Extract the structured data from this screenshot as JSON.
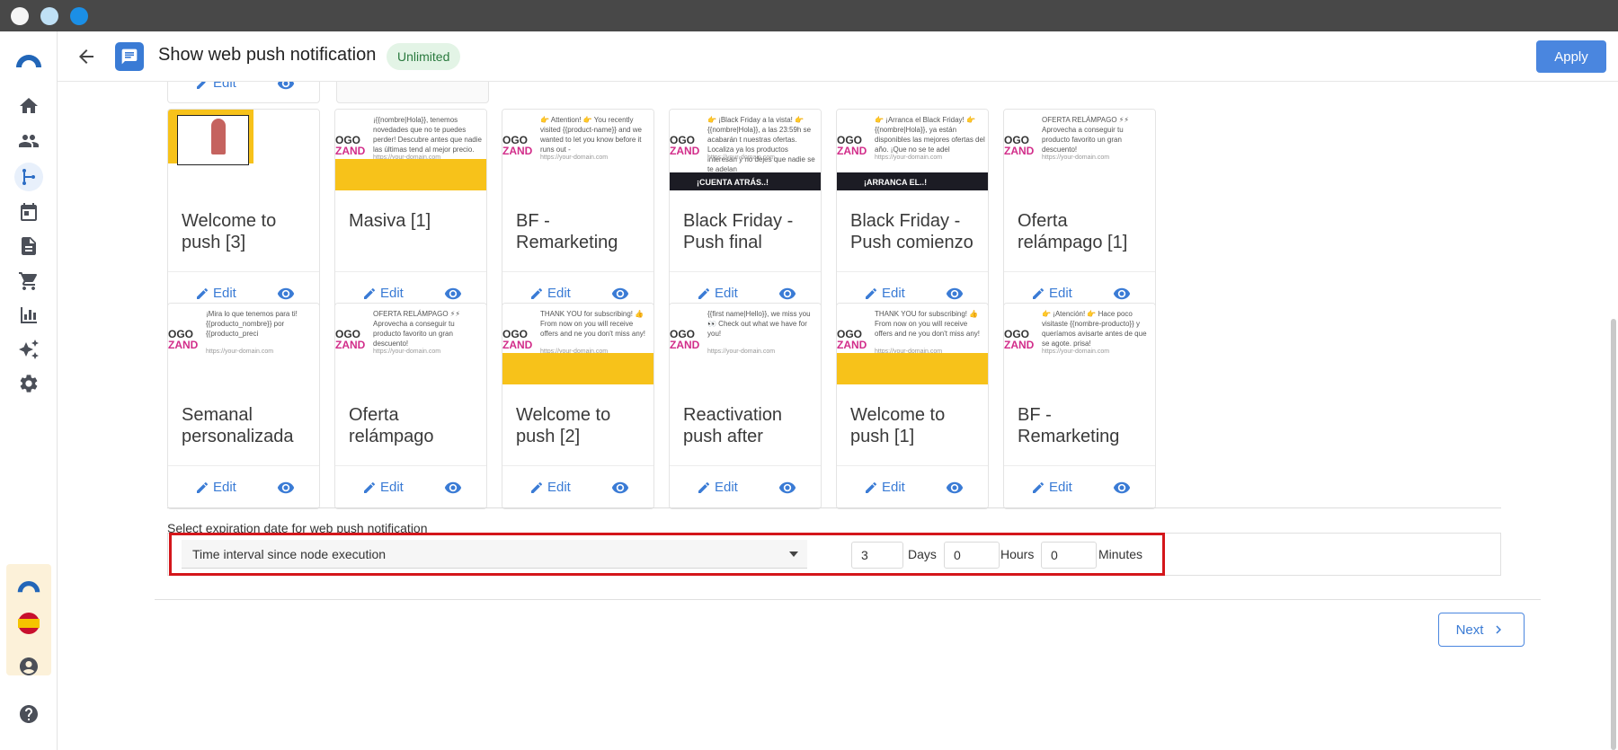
{
  "header": {
    "title": "Show web push notification",
    "badge": "Unlimited",
    "apply_label": "Apply"
  },
  "rail_icons": [
    "home-icon",
    "people-icon",
    "flow-icon",
    "calendar-icon",
    "document-icon",
    "cart-icon",
    "chart-icon",
    "sparkle-icon",
    "gear-icon",
    "account-icon",
    "help-icon"
  ],
  "cards_top": [
    {
      "edit": "Edit"
    }
  ],
  "cards_row1": [
    {
      "name": "Welcome to push [3]",
      "edit": "Edit"
    },
    {
      "name": "Masiva [1]",
      "edit": "Edit",
      "msg": "¡{{nombre|Hola}}, tenemos novedades que no te puedes perder! Descubre antes que nadie las últimas tend al mejor precio.",
      "url": "https://your-domain.com"
    },
    {
      "name": "BF - Remarketing",
      "edit": "Edit",
      "msg": "👉 Attention! 👉 You recently visited {{product-name}} and we wanted to let you know before it runs out -",
      "url": "https://your-domain.com"
    },
    {
      "name": "Black Friday - Push final",
      "edit": "Edit",
      "msg": "👉 ¡Black Friday a la vista! 👉 {{nombre|Hola}}, a las 23:59h se acabarán t nuestras ofertas. Localiza ya los productos interesan y no dejes que nadie se te adelan",
      "url": "https://your-domain.com",
      "banner": "¡CUENTA ATRÁS..!"
    },
    {
      "name": "Black Friday - Push comienzo",
      "edit": "Edit",
      "msg": "👉 ¡Arranca el Black Friday! 👉 {{nombre|Hola}}, ya están disponibles las mejores ofertas del año. ¡Que no se te adel",
      "url": "https://your-domain.com",
      "banner": "¡ARRANCA EL..!"
    },
    {
      "name": "Oferta relámpago [1]",
      "edit": "Edit",
      "msg": "OFERTA RELÁMPAGO ⚡⚡ Aprovecha a conseguir tu producto favorito un gran descuento!",
      "url": "https://your-domain.com"
    }
  ],
  "cards_row2": [
    {
      "name": "Semanal personalizada",
      "edit": "Edit",
      "msg": "¡Mira lo que tenemos para ti! {{producto_nombre}} por {{producto_preci",
      "url": "https://your-domain.com"
    },
    {
      "name": "Oferta relámpago",
      "edit": "Edit",
      "msg": "OFERTA RELÁMPAGO ⚡⚡ Aprovecha a conseguir tu producto favorito un gran descuento!",
      "url": "https://your-domain.com"
    },
    {
      "name": "Welcome to push [2]",
      "edit": "Edit",
      "msg": "THANK YOU for subscribing! 👍 From now on you will receive offers and ne you don't miss any!",
      "url": "https://your-domain.com"
    },
    {
      "name": "Reactivation push after",
      "edit": "Edit",
      "msg": "{{first name|Hello}}, we miss you 👀 Check out what we have for you!",
      "url": "https://your-domain.com"
    },
    {
      "name": "Welcome to push [1]",
      "edit": "Edit",
      "msg": "THANK YOU for subscribing! 👍 From now on you will receive offers and ne you don't miss any!",
      "url": "https://your-domain.com"
    },
    {
      "name": "BF - Remarketing",
      "edit": "Edit",
      "msg": "👉 ¡Atención! 👉 Hace poco visitaste {{nombre-producto}} y queríamos avisarte antes de que se agote. prisa!",
      "url": "https://your-domain.com"
    }
  ],
  "logo_text": "OGO\nZAND",
  "expiration": {
    "label": "Select expiration date for web push notification",
    "mode": "Time interval since node execution",
    "days": "3",
    "days_label": "Days",
    "hours": "0",
    "hours_label": "Hours",
    "minutes": "0",
    "minutes_label": "Minutes"
  },
  "footer": {
    "next_label": "Next"
  },
  "colors": {
    "accent": "#3a7bd5",
    "apply_bg": "#4a86df",
    "badge_bg": "#e3f4e6",
    "badge_text": "#2a7a3e",
    "highlight": "#d4161b",
    "titlebar": "#484848"
  }
}
